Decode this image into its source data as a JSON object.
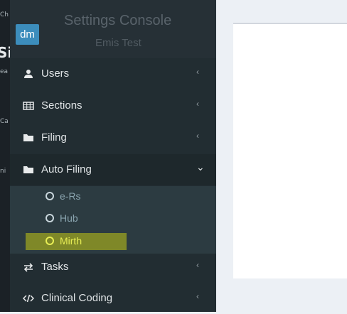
{
  "desktop": {
    "fragments": [
      "Ch",
      "Si",
      "ea",
      "Ca",
      "ni"
    ]
  },
  "header": {
    "logo": "dm",
    "title": "Settings Console",
    "subtitle": "Emis Test"
  },
  "menu": {
    "items": [
      {
        "label": "Users",
        "icon": "user-icon",
        "chevron": "‹"
      },
      {
        "label": "Sections",
        "icon": "table-icon",
        "chevron": "‹"
      },
      {
        "label": "Filing",
        "icon": "folder-icon",
        "chevron": "‹"
      },
      {
        "label": "Auto Filing",
        "icon": "folder-icon",
        "chevron": "⌄"
      },
      {
        "label": "Tasks",
        "icon": "exchange-icon",
        "chevron": "‹"
      },
      {
        "label": "Clinical Coding",
        "icon": "code-icon",
        "chevron": "‹"
      }
    ],
    "submenu": [
      {
        "label": "e-Rs"
      },
      {
        "label": "Hub"
      },
      {
        "label": "Mirth",
        "highlighted": true
      }
    ]
  },
  "colors": {
    "sidebar": "#222d32",
    "accent": "#3c8dbc",
    "highlight": "#c9cc1a"
  }
}
